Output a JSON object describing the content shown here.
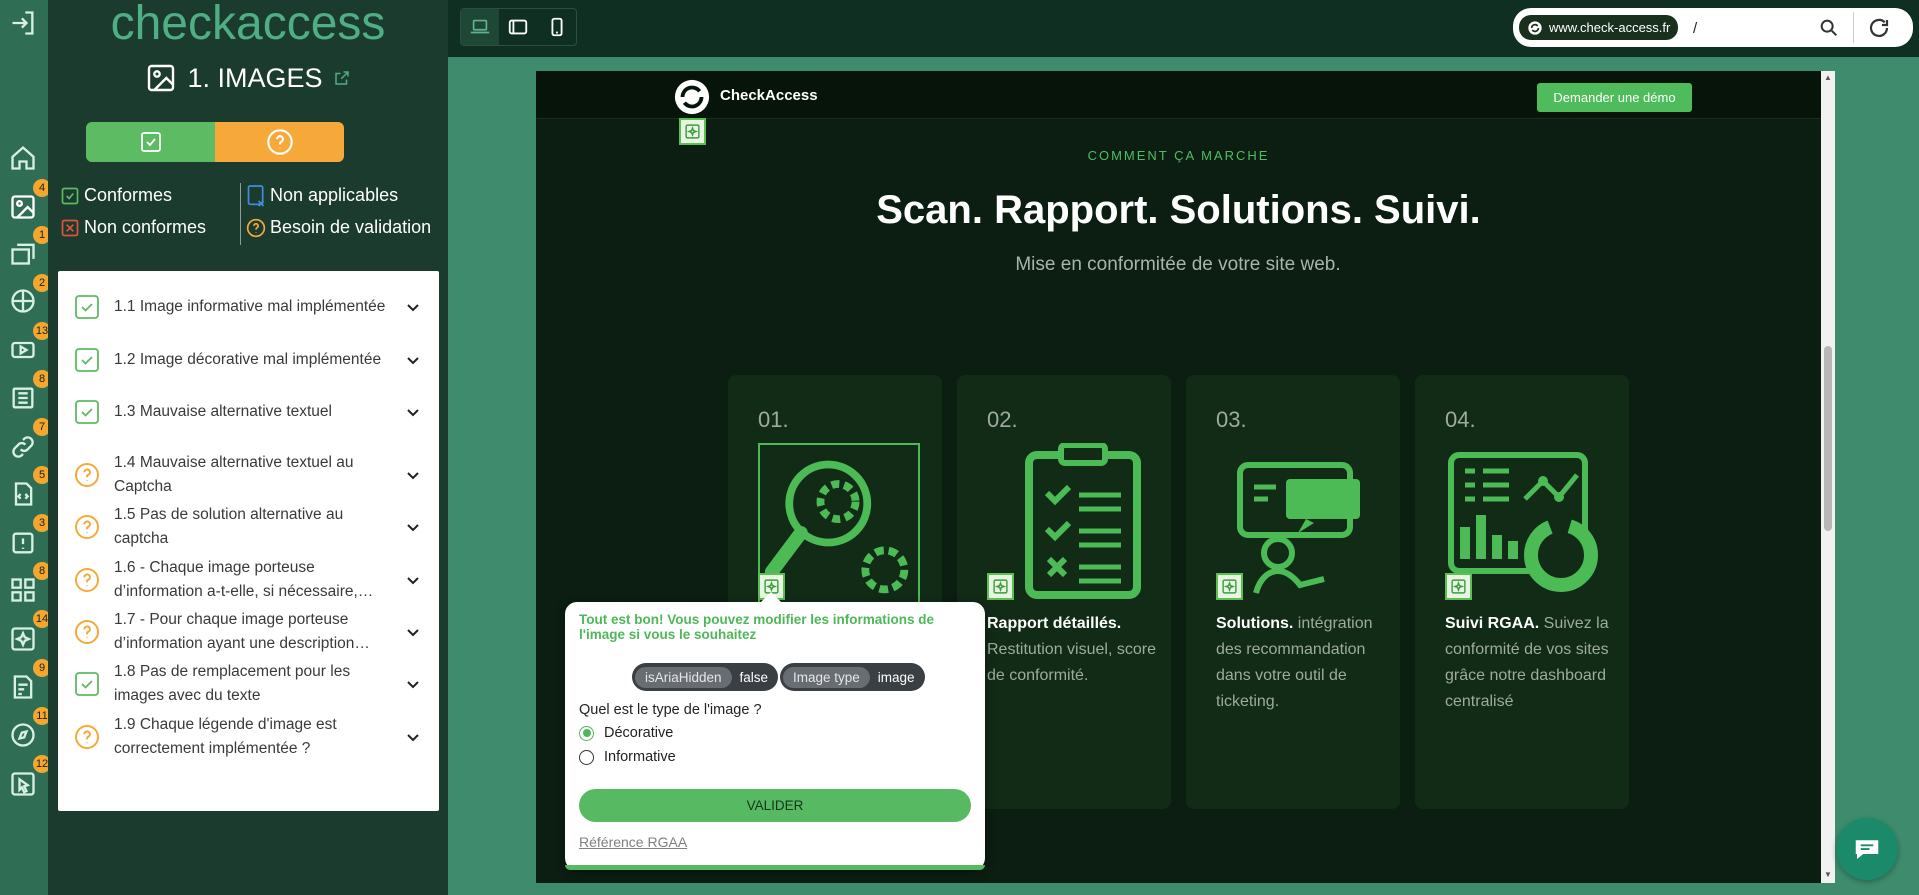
{
  "rail": {
    "badges": [
      "4",
      "1",
      "2",
      "13",
      "8",
      "7",
      "5",
      "3",
      "8",
      "14",
      "9",
      "11",
      "12"
    ]
  },
  "panel": {
    "brand": "checkaccess",
    "criterion_title": "1. IMAGES",
    "legend": {
      "conformes": "Conformes",
      "non_applicables": "Non applicables",
      "non_conformes": "Non conformes",
      "besoin_validation": "Besoin de validation"
    },
    "items": [
      {
        "status": "ok",
        "label": "1.1 Image informative mal implémentée"
      },
      {
        "status": "ok",
        "label": "1.2 Image décorative mal implémentée"
      },
      {
        "status": "ok",
        "label": "1.3 Mauvaise alternative textuel"
      },
      {
        "status": "question",
        "label": "1.4 Mauvaise alternative textuel au Captcha"
      },
      {
        "status": "question",
        "label": "1.5 Pas de solution alternative au captcha"
      },
      {
        "status": "question",
        "label": "1.6 - Chaque image porteuse d’information a-t-elle, si nécessaire,…"
      },
      {
        "status": "question",
        "label": "1.7 - Pour chaque image porteuse d’information ayant une description…"
      },
      {
        "status": "ok",
        "label": "1.8 Pas de remplacement pour les images avec du texte"
      },
      {
        "status": "question",
        "label": "1.9 Chaque légende d'image est correctement implémentée ?"
      }
    ]
  },
  "toolbar": {
    "host": "www.check-access.fr",
    "path": "/"
  },
  "site": {
    "name": "CheckAccess",
    "demo_button": "Demander une démo",
    "kicker": "COMMENT ÇA MARCHE",
    "headline": "Scan. Rapport. Solutions. Suivi.",
    "subtitle": "Mise en conformitée de votre site web.",
    "cards": [
      {
        "num": "01.",
        "bold": "",
        "text": ""
      },
      {
        "num": "02.",
        "bold": "Rapport détaillés.",
        "text": " Restitution visuel, score de conformité."
      },
      {
        "num": "03.",
        "bold": "Solutions.",
        "text": " intégration des recommandation dans votre outil de ticketing."
      },
      {
        "num": "04.",
        "bold": "Suivi RGAA.",
        "text": " Suivez la conformité de vos sites grâce notre dashboard centralisé"
      }
    ]
  },
  "popover": {
    "title": "Tout est bon! Vous pouvez modifier les informations de l'image si vous le souhaitez",
    "chip1_key": "isAriaHidden",
    "chip1_val": "false",
    "chip2_key": "Image type",
    "chip2_val": "image",
    "question": "Quel est le type de l'image ?",
    "option1": "Décorative",
    "option2": "Informative",
    "selected": "Décorative",
    "validate": "VALIDER",
    "reference": "Référence RGAA"
  },
  "colors": {
    "accent_green": "#5dbb63",
    "warning_orange": "#f6a93a",
    "error_red": "#e2533c",
    "na_blue": "#3f8fe0"
  }
}
